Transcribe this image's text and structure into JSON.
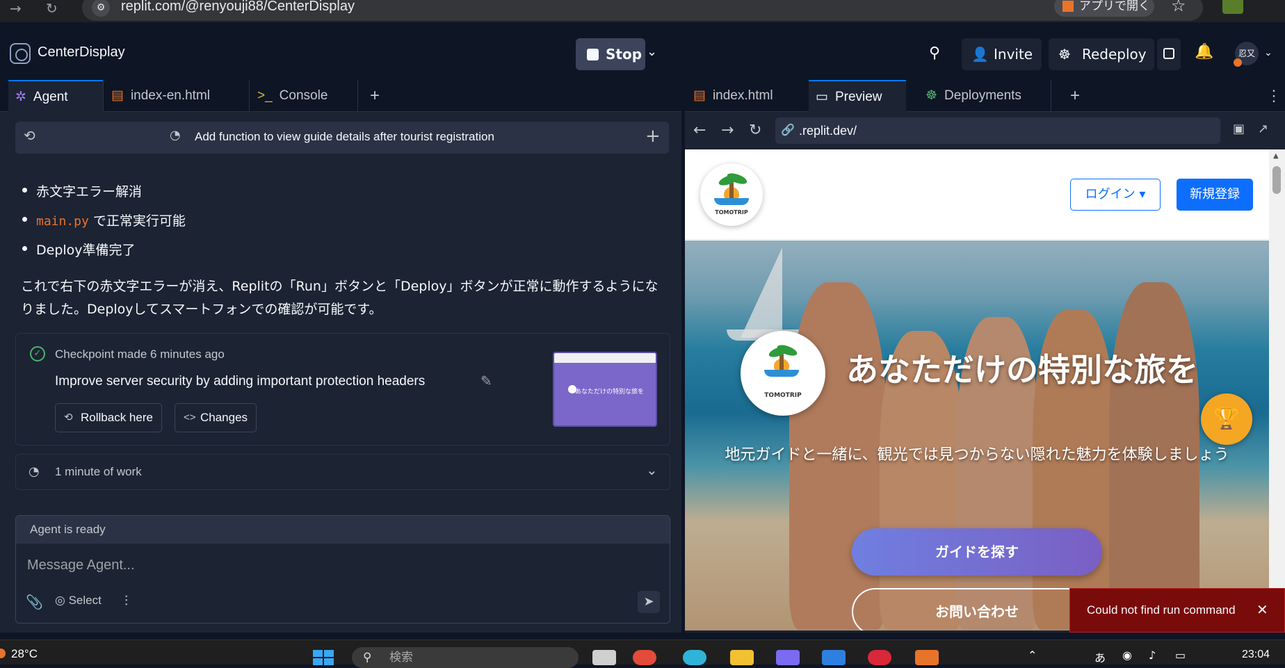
{
  "browser": {
    "url": "replit.com/@renyouji88/CenterDisplay",
    "open_app_label": "アプリで開く"
  },
  "header": {
    "project_name": "CenterDisplay",
    "stop_label": "Stop",
    "invite_label": "Invite",
    "redeploy_label": "Redeploy",
    "avatar_text": "忍又"
  },
  "left_tabs": [
    {
      "label": "Agent"
    },
    {
      "label": "index-en.html"
    },
    {
      "label": "Console"
    }
  ],
  "chat": {
    "task_title": "Add function to view guide details after tourist registration",
    "bullets": [
      "赤文字エラー解消",
      "で正常実行可能",
      "Deploy準備完了"
    ],
    "bullet_code": "main.py",
    "paragraph": "これで右下の赤文字エラーが消え、Replitの「Run」ボタンと「Deploy」ボタンが正常に動作するようになりました。Deployしてスマートフォンでの確認が可能です。",
    "checkpoint": {
      "meta": "Checkpoint made 6 minutes ago",
      "description": "Improve server security by adding important protection headers",
      "rollback_label": "Rollback here",
      "changes_label": "Changes",
      "thumb_text": "あなただけの特別な旅を"
    },
    "work_label": "1 minute of work",
    "composer": {
      "status": "Agent is ready",
      "placeholder": "Message Agent...",
      "select_label": "Select"
    }
  },
  "right_tabs": [
    {
      "label": "index.html"
    },
    {
      "label": "Preview"
    },
    {
      "label": "Deployments"
    }
  ],
  "preview": {
    "url": ".replit.dev/",
    "site": {
      "logo_text": "TOMOTRIP",
      "brand": "TomoTrip",
      "login_label": "ログイン",
      "signup_label": "新規登録",
      "hero_title": "あなただけの特別な旅を",
      "hero_subtitle": "地元ガイドと一緒に、観光では見つからない隠れた魅力を体験しましょう",
      "cta_primary": "ガイドを探す",
      "cta_secondary": "お問い合わせ"
    }
  },
  "toast": {
    "message": "Could not find run command"
  },
  "taskbar": {
    "temperature": "28°C",
    "search_placeholder": "検索",
    "time": "23:04",
    "ime": "あ"
  },
  "colors": {
    "accent_blue": "#0079f2",
    "primary_button": "#0d6efd",
    "toast_bg": "#7a0b0b",
    "checkpoint_green": "#4db36a"
  }
}
